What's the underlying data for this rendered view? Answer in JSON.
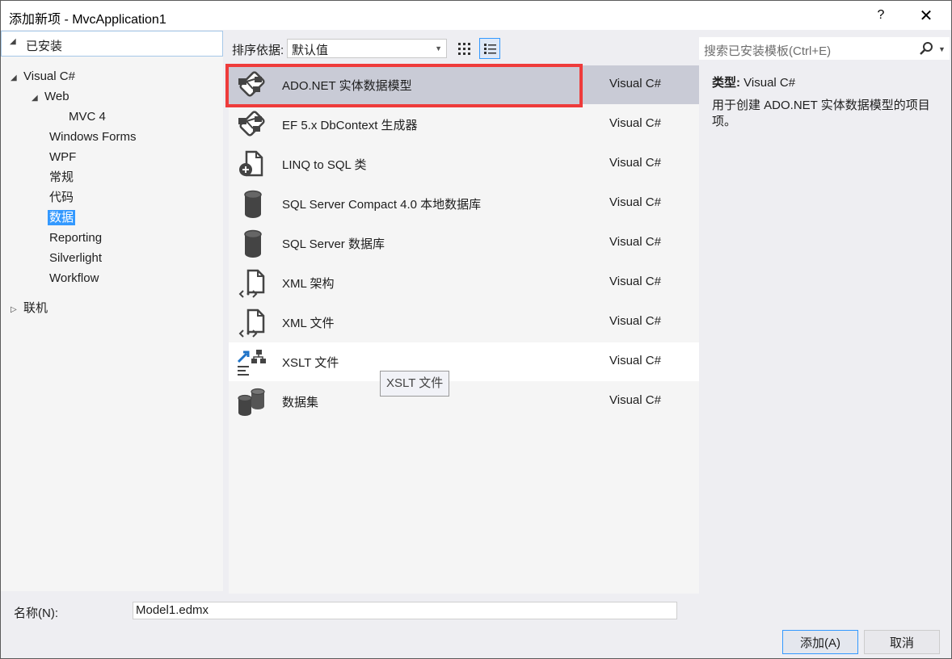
{
  "window": {
    "title": "添加新项 - MvcApplication1",
    "help": "?",
    "close": "✕"
  },
  "left": {
    "installed": "已安装",
    "tree": [
      {
        "label": "Visual C#",
        "toggle": "◢"
      },
      {
        "label": "Web",
        "toggle": "◢"
      },
      {
        "label": "MVC 4"
      },
      {
        "label": "Windows Forms"
      },
      {
        "label": "WPF"
      },
      {
        "label": "常规"
      },
      {
        "label": "代码"
      },
      {
        "label": "数据",
        "selected": true
      },
      {
        "label": "Reporting"
      },
      {
        "label": "Silverlight"
      },
      {
        "label": "Workflow"
      },
      {
        "label": "联机",
        "toggle": "▷"
      }
    ]
  },
  "toolbar": {
    "sort_label": "排序依据:",
    "sort_value": "默认值"
  },
  "search": {
    "placeholder": "搜索已安装模板(Ctrl+E)"
  },
  "templates": [
    {
      "name": "ADO.NET 实体数据模型",
      "lang": "Visual C#",
      "icon": "entity-model-icon",
      "state": "selected"
    },
    {
      "name": "EF 5.x DbContext 生成器",
      "lang": "Visual C#",
      "icon": "dbcontext-generator-icon"
    },
    {
      "name": "LINQ to SQL 类",
      "lang": "Visual C#",
      "icon": "linq-to-sql-icon"
    },
    {
      "name": "SQL Server Compact 4.0 本地数据库",
      "lang": "Visual C#",
      "icon": "database-icon"
    },
    {
      "name": "SQL Server 数据库",
      "lang": "Visual C#",
      "icon": "database-icon"
    },
    {
      "name": "XML 架构",
      "lang": "Visual C#",
      "icon": "xml-schema-icon"
    },
    {
      "name": "XML 文件",
      "lang": "Visual C#",
      "icon": "xml-file-icon"
    },
    {
      "name": "XSLT 文件",
      "lang": "Visual C#",
      "icon": "xslt-file-icon",
      "state": "hover"
    },
    {
      "name": "数据集",
      "lang": "Visual C#",
      "icon": "dataset-icon"
    }
  ],
  "tooltip": "XSLT 文件",
  "details": {
    "type_label": "类型:",
    "type_value": "Visual C#",
    "description": "用于创建 ADO.NET 实体数据模型的项目项。"
  },
  "bottom": {
    "name_label": "名称(N):",
    "name_value": "Model1.edmx",
    "add_label": "添加(A)",
    "cancel_label": "取消"
  },
  "colors": {
    "accent": "#3399ff",
    "highlight_box": "#ee3b3b",
    "selected_row": "#c9cbd6"
  }
}
